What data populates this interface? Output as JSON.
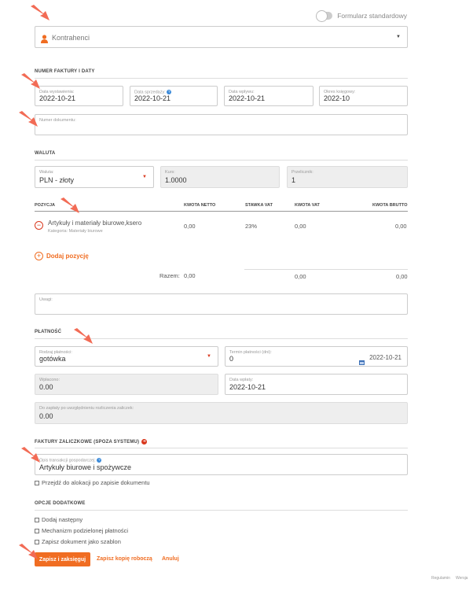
{
  "toggle": {
    "label": "Formularz standardowy"
  },
  "contractor": {
    "placeholder": "Kontrahenci"
  },
  "invoice": {
    "section_title": "NUMER FAKTURY I DATY",
    "issue_date": {
      "label": "Data wystawienia:",
      "value": "2022-10-21"
    },
    "sale_date": {
      "label": "Data sprzedaży:",
      "value": "2022-10-21"
    },
    "receipt_date": {
      "label": "Data wpływu:",
      "value": "2022-10-21"
    },
    "tax_period": {
      "label": "Okres księgowy:",
      "value": "2022-10"
    },
    "doc_number": {
      "label": "Numer dokumentu:",
      "value": ""
    }
  },
  "currency": {
    "section_title": "WALUTA",
    "currency": {
      "label": "Waluta:",
      "value": "PLN - złoty"
    },
    "rate": {
      "label": "Kurs:",
      "value": "1.0000"
    },
    "multiplier": {
      "label": "Przelicznik:",
      "value": "1"
    }
  },
  "items": {
    "headers": {
      "position": "POZYCJA",
      "net": "KWOTA NETTO",
      "vat_rate": "STAWKA VAT",
      "vat": "KWOTA VAT",
      "gross": "KWOTA BRUTTO"
    },
    "rows": [
      {
        "name": "Artykuły i materiały biurowe,ksero",
        "category": "Kategoria: Materiały biurowe",
        "net": "0,00",
        "vat_rate": "23%",
        "vat": "0,00",
        "gross": "0,00"
      }
    ],
    "add_label": "Dodaj pozycję",
    "total_label": "Razem:",
    "total_net": "0,00",
    "total_vat": "0,00",
    "total_gross": "0,00"
  },
  "notes": {
    "label": "Uwagi:"
  },
  "payment": {
    "section_title": "PŁATNOŚĆ",
    "method": {
      "label": "Rodzaj płatności:",
      "value": "gotówka"
    },
    "term": {
      "label": "Termin płatności (dni):",
      "value": "0",
      "date": "2022-10-21"
    },
    "paid": {
      "label": "Wpłacono:",
      "value": "0.00"
    },
    "paid_date": {
      "label": "Data wpłaty:",
      "value": "2022-10-21"
    },
    "to_pay": {
      "label": "Do zapłaty po uwzględnieniu rozliczenia zaliczek:",
      "value": "0.00"
    }
  },
  "advance": {
    "section_title": "FAKTURY ZALICZKOWE (SPOZA SYSTEMU)",
    "description": {
      "label": "Opis transakcji gospodarczej:",
      "value": "Artykuły biurowe i spożywcze"
    },
    "allocate_label": "Przejdź do alokacji po zapisie dokumentu"
  },
  "options": {
    "section_title": "OPCJE DODATKOWE",
    "items": [
      "Dodaj następny",
      "Mechanizm podzielonej płatności",
      "Zapisz dokument jako szablon"
    ]
  },
  "actions": {
    "save": "Zapisz i zaksięguj",
    "draft": "Zapisz kopię roboczą",
    "cancel": "Anuluj"
  },
  "footer": {
    "terms": "Regulamin",
    "version": "Wersja"
  },
  "colors": {
    "accent": "#f06d22",
    "arrow": "#f26b55",
    "required": "#d9381e"
  }
}
